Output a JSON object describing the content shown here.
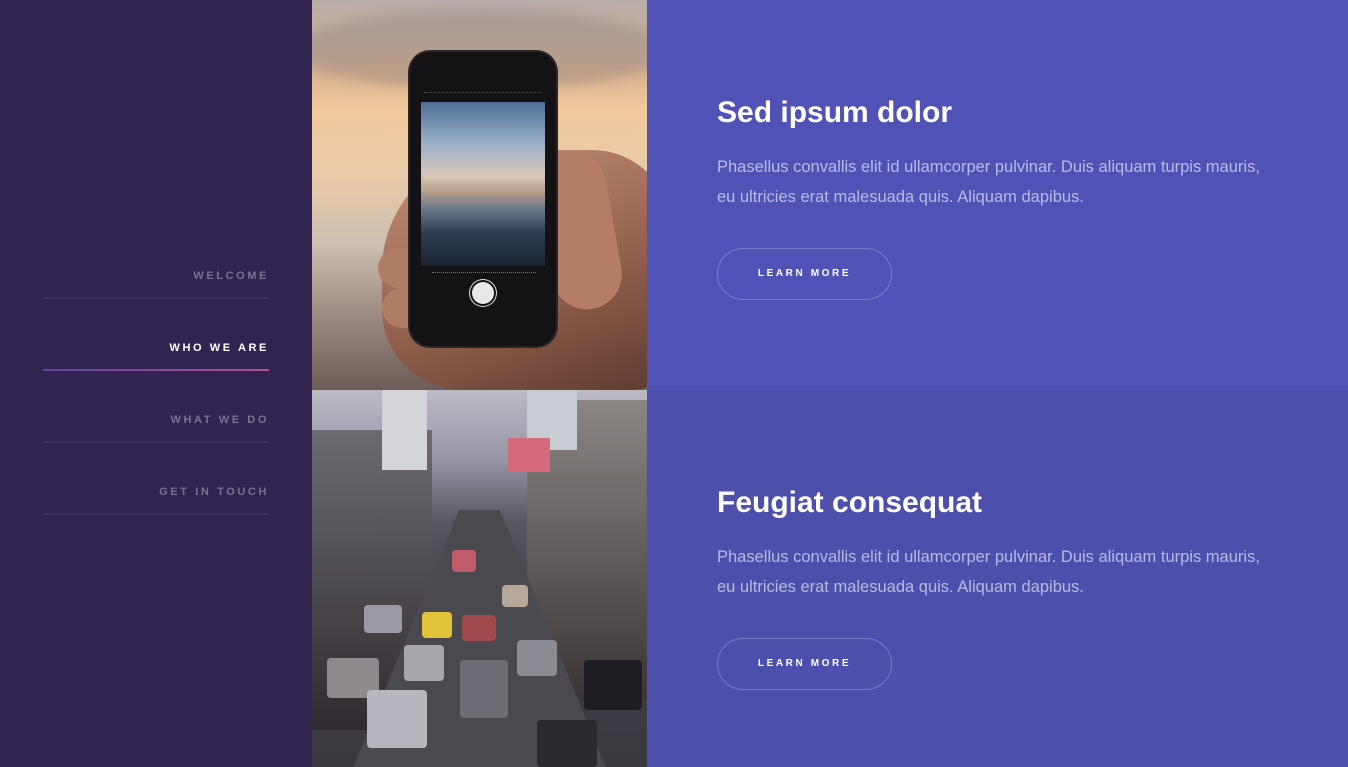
{
  "nav": {
    "items": [
      {
        "label": "WELCOME",
        "active": false
      },
      {
        "label": "WHO WE ARE",
        "active": true
      },
      {
        "label": "WHAT WE DO",
        "active": false
      },
      {
        "label": "GET IN TOUCH",
        "active": false
      }
    ]
  },
  "spotlights": [
    {
      "title": "Sed ipsum dolor",
      "text": "Phasellus convallis elit id ullamcorper pulvinar. Duis aliquam turpis mauris, eu ultricies erat malesuada quis. Aliquam dapibus.",
      "button": "LEARN MORE",
      "image": "phone-photo"
    },
    {
      "title": "Feugiat consequat",
      "text": "Phasellus convallis elit id ullamcorper pulvinar. Duis aliquam turpis mauris, eu ultricies erat malesuada quis. Aliquam dapibus.",
      "button": "LEARN MORE",
      "image": "street-photo"
    }
  ],
  "colors": {
    "sidebar": "#312450",
    "spotlight1": "#5052b5",
    "spotlight2": "#4c4fab",
    "accent_gradient": [
      "#5e42a6",
      "#b74e91"
    ]
  }
}
